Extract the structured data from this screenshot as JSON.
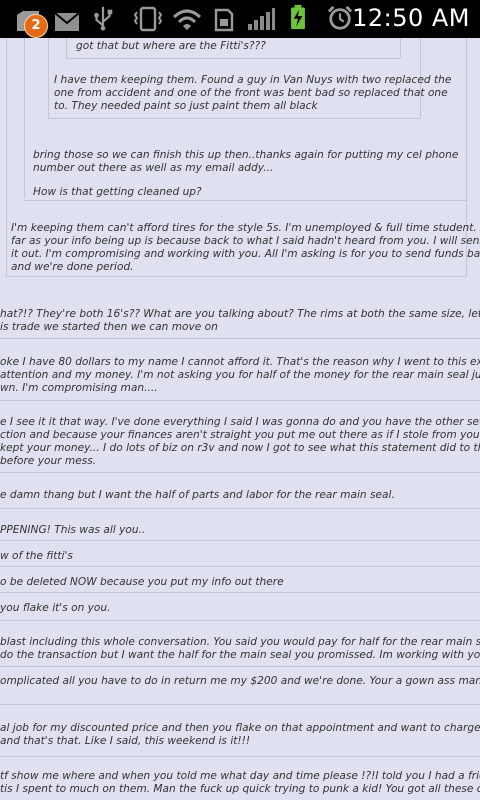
{
  "status_bar": {
    "notification_count": "2",
    "time": "12:50 AM",
    "icons": [
      "app-notification-icon",
      "gmail-icon",
      "usb-icon",
      "vibrate-icon",
      "wifi-icon",
      "sim-icon",
      "signal-icon",
      "battery-charging-icon",
      "alarm-icon"
    ]
  },
  "messages": [
    {
      "lines": [
        "got that but where are the Fitti's???"
      ]
    },
    {
      "lines": [
        "I have them keeping them. Found a guy in Van Nuys with two replaced the",
        "one from accident and one of the front was bent bad so replaced that one",
        "to. They needed paint so just paint them all black"
      ]
    },
    {
      "lines": [
        "bring those so we can finish this up then..thanks again for putting my cel phone",
        "number out there as well as my email addy..."
      ]
    },
    {
      "lines": [
        "How is that getting cleaned up?"
      ]
    },
    {
      "lines": [
        "I'm keeping them can't afford tires for the style 5s. I'm unemployed & full time student. As",
        "far as your info being up is because back to what I said hadn't heard from you. I will sensor",
        "it out. I'm compromising and working with you. All I'm asking is for you to send funds back",
        "and we're done period."
      ]
    },
    {
      "lines": [
        "hat?!? They're both 16's?? What are you talking about? The rims at both the same size, let's finish up",
        "is trade we started then we can move on"
      ]
    },
    {
      "lines": [
        "oke I have 80 dollars to my name I cannot afford it. That's the reason why I went to this extent to ge",
        "attention and my money. I'm not asking you for half of the money for the rear main seal just my mon",
        "wn. I'm compromising man...."
      ]
    },
    {
      "lines": [
        "e I see it it that way. I've done everything I said I was gonna do and you have the other set of wheels",
        "ction and because your finances aren't straight you put me out there as if I stole from you. Then say",
        "kept your money... I do lots of biz on r3v and now I got to see what this statement did to the peeps",
        "before your mess."
      ]
    },
    {
      "lines": [
        "e damn thang but I want the half of parts and labor for the rear main seal."
      ]
    },
    {
      "lines": [
        "PPENING! This was all you.."
      ]
    },
    {
      "lines": [
        "w of the fitti's"
      ]
    },
    {
      "lines": [
        "o be deleted NOW because you put my info out there"
      ]
    },
    {
      "lines": [
        "you flake it's on you."
      ]
    },
    {
      "lines": [
        "blast including this whole conversation. You said you would pay for half for the rear main seal so I w",
        "do the transaction but I want the half for the main seal you promissed. Im working with you but lo"
      ]
    },
    {
      "lines": [
        "omplicated all you have to do in return me my $200 and we're done. Your a gown ass man taking ac"
      ]
    },
    {
      "lines": [
        "al job for my discounted price and then you flake on that appointment and want to charge me??? On",
        "and that's that. Like I said, this weekend is it!!!"
      ]
    },
    {
      "lines": [
        "tf show me where and when you told me what day and time please !?!I told you I had a friend who w",
        "tis I spent to much on them. Man the fuck up quick trying to punk a kid! You got all these cars and s"
      ]
    }
  ]
}
